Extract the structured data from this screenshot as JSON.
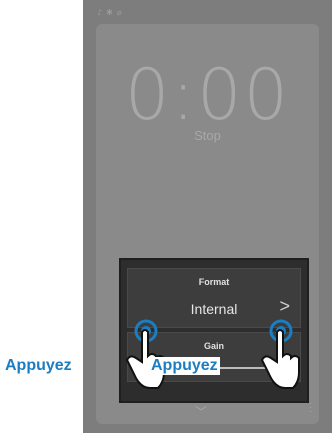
{
  "status_bar": {
    "icons": [
      "headphones-icon",
      "bluetooth-icon",
      "microphone-icon"
    ]
  },
  "timer": {
    "time": "0:00",
    "state": "Stop"
  },
  "dialog": {
    "format": {
      "title": "Format",
      "value": "Internal",
      "chevron": ">"
    },
    "gain": {
      "title": "Gain"
    }
  },
  "annotations": {
    "tap_left": "Appuyez",
    "tap_right": "Appuyez"
  },
  "colors": {
    "accent": "#1b7ec2",
    "device_bg": "#7d7d7d",
    "dialog_bg": "#2d2d2d"
  }
}
